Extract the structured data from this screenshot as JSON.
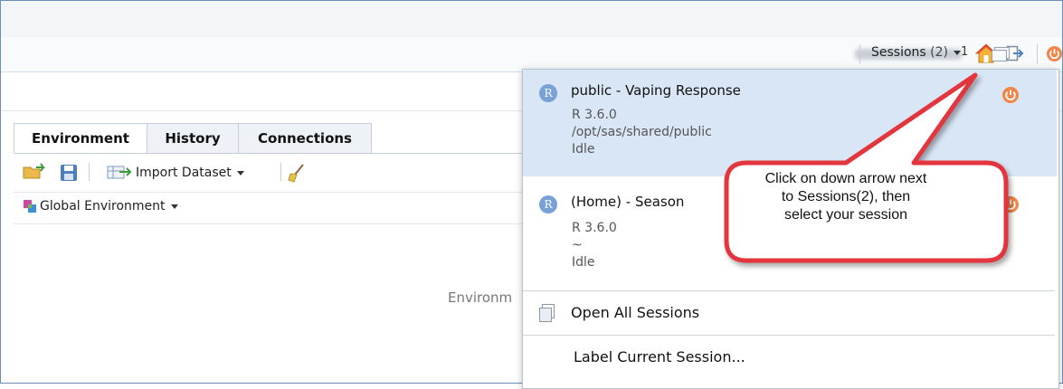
{
  "header": {
    "user_suffix": "1",
    "sessions_label": "Sessions",
    "sessions_count": "(2)"
  },
  "tabs": [
    {
      "label": "Environment",
      "active": true
    },
    {
      "label": "History",
      "active": false
    },
    {
      "label": "Connections",
      "active": false
    }
  ],
  "pane_toolbar": {
    "import_label": "Import Dataset"
  },
  "environment": {
    "scope_label": "Global Environment",
    "empty_text": "Environm"
  },
  "sessions_menu": {
    "sessions": [
      {
        "badge": "R",
        "title": "public - Vaping Response",
        "version": "R 3.6.0",
        "path": "/opt/sas/shared/public",
        "status": "Idle",
        "selected": true
      },
      {
        "badge": "R",
        "title": "(Home) - Season",
        "version": "R 3.6.0",
        "path": "~",
        "status": "Idle",
        "selected": false
      }
    ],
    "open_all_label": "Open All Sessions",
    "label_current_label": "Label Current Session..."
  },
  "callout": {
    "text_line1": "Click on down arrow next",
    "text_line2": "to Sessions(2), then",
    "text_line3": "select your session",
    "fill_color": "#ffffff",
    "border_color": "#e2363c"
  },
  "colors": {
    "power_orange": "#f0874a",
    "r_badge": "#7aa1d6",
    "selected_bg": "#d9e6f5"
  }
}
